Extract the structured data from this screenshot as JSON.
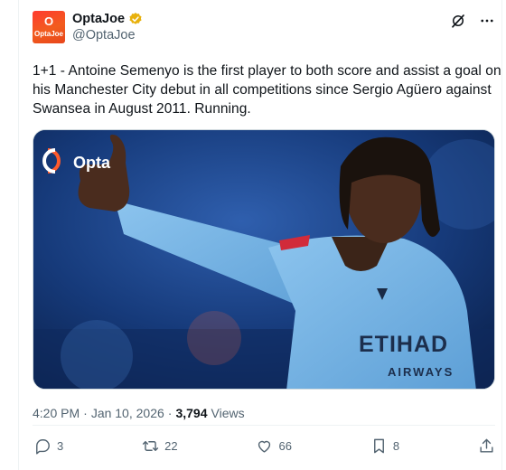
{
  "account": {
    "display_name": "OptaJoe",
    "handle": "@OptaJoe",
    "avatar_glyph": "O",
    "avatar_word": "OptaJoe",
    "verified_icon": "gold-verified-badge"
  },
  "tweet": {
    "text": "1+1 - Antoine Semenyo is the first player to both score and assist a goal on his Manchester City debut in all competitions since Sergio Agüero against Swansea in August 2011. Running.",
    "media_watermark": "Opta",
    "shirt_sponsor": "ETIHAD",
    "shirt_sponsor_sub": "AIRWAYS",
    "time": "4:20 PM",
    "date": "Jan 10, 2026",
    "views_count": "3,794",
    "views_label": "Views"
  },
  "actions": {
    "replies": "3",
    "reposts": "22",
    "likes": "66",
    "bookmarks": "8"
  },
  "colors": {
    "verified": "#e8b10c",
    "avatar": "#f0402a",
    "shirt": "#6cabdd",
    "muted_text": "#536471"
  }
}
